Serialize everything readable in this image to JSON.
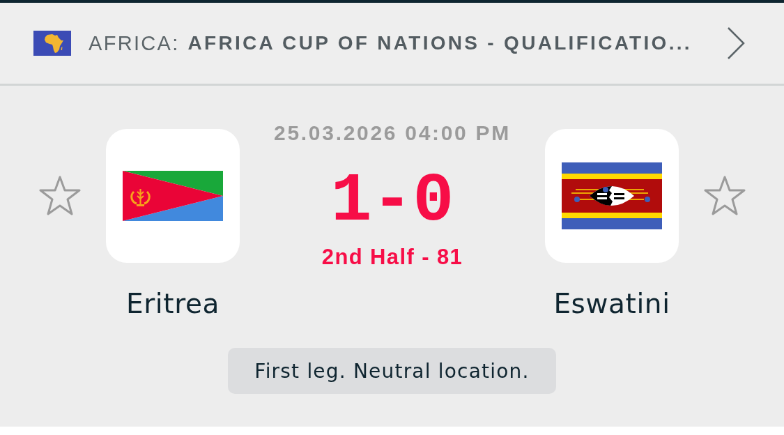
{
  "competition": {
    "region": "AFRICA:",
    "name": "AFRICA CUP OF NATIONS - QUALIFICATIO..."
  },
  "match": {
    "datetime": "25.03.2026 04:00 PM",
    "score": "1-0",
    "status": "2nd Half - 81"
  },
  "teams": [
    {
      "name": "Eritrea",
      "favorite": false
    },
    {
      "name": "Eswatini",
      "favorite": false
    }
  ],
  "note": "First leg. Neutral location."
}
